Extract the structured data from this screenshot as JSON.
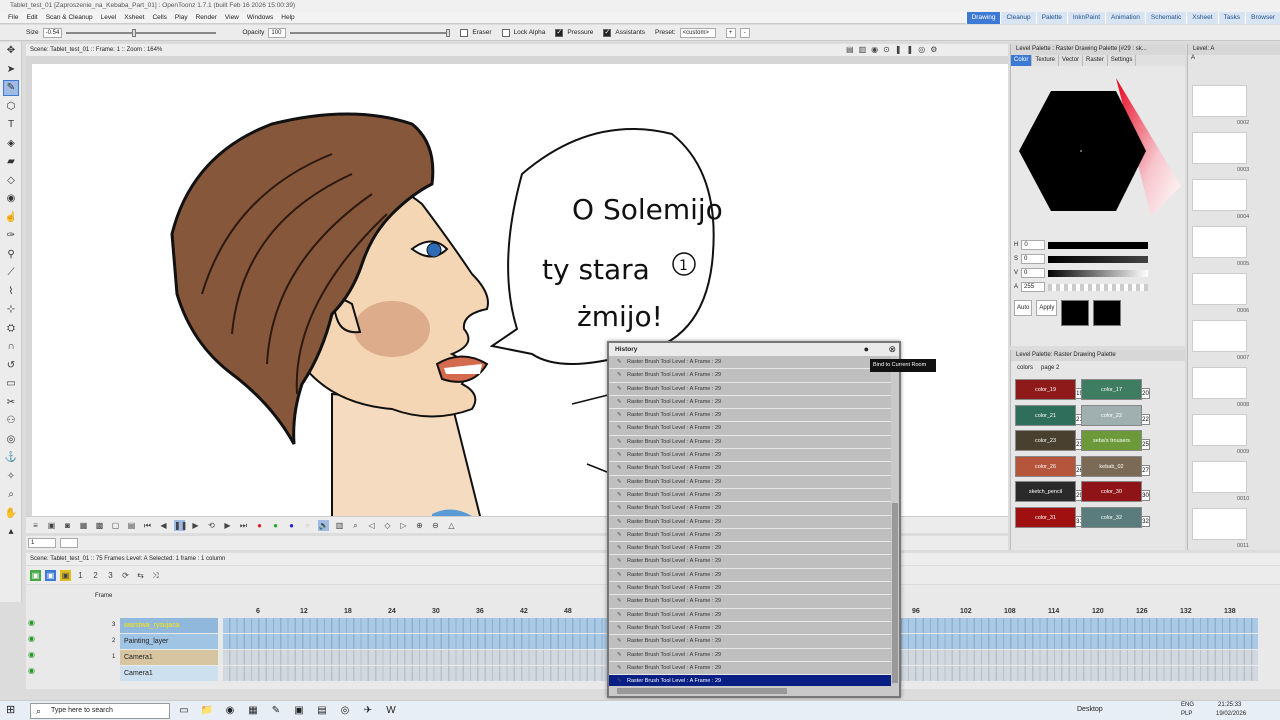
{
  "window": {
    "title": "Tablet_test_01 [Zaproszenie_na_Kebaba_Part_01] : OpenToonz 1.7.1 (built Feb 16 2026 15:00:39)"
  },
  "menu": [
    "File",
    "Edit",
    "Scan & Cleanup",
    "Level",
    "Xsheet",
    "Cells",
    "Play",
    "Render",
    "View",
    "Windows",
    "Help"
  ],
  "rooms": [
    "Drawing",
    "Cleanup",
    "Palette",
    "InknPaint",
    "Animation",
    "Schematic",
    "Xsheet",
    "Tasks",
    "Browser"
  ],
  "tool_options": {
    "size_label": "Size",
    "size_value": "-0.54",
    "opacity_label": "Opacity",
    "opacity_value": "100",
    "eraser": "Eraser",
    "lock_alpha": "Lock Alpha",
    "pressure": "Pressure",
    "assistants": "Assistants",
    "preset_label": "Preset:",
    "preset_value": "<custom>"
  },
  "viewer": {
    "header": "Scene: Tablet_test_01  ::  Frame: 1  ::  Zoom : 164%",
    "frame_field": "1"
  },
  "drawing": {
    "line1": "O  Solemijo",
    "line2": "ty  stara",
    "line3": "żmijo!",
    "circled": "1"
  },
  "style_editor": {
    "title": "Level Palette : Raster Drawing Palette [#29 : sk...",
    "tabs": [
      "Color",
      "Texture",
      "Vector",
      "Raster",
      "Settings"
    ],
    "h_label": "H",
    "h_value": "0",
    "s_label": "S",
    "s_value": "0",
    "v_label": "V",
    "v_value": "0",
    "a_label": "A",
    "a_value": "255",
    "auto_label": "Auto",
    "apply_label": "Apply"
  },
  "palette": {
    "title": "Level Palette: Raster Drawing Palette",
    "tabs": [
      "colors",
      "page 2"
    ],
    "chips": [
      {
        "name": "color_19",
        "idx": "19",
        "color": "#8e1a1a"
      },
      {
        "name": "color_17",
        "idx": "20",
        "color": "#3f7d62"
      },
      {
        "name": "color_21",
        "idx": "21",
        "color": "#2e6e5a"
      },
      {
        "name": "color_22",
        "idx": "22",
        "color": "#a0b0b0"
      },
      {
        "name": "color_23",
        "idx": "23",
        "color": "#4a4030"
      },
      {
        "name": "seba's trousers",
        "idx": "25",
        "color": "#6c9a3a"
      },
      {
        "name": "color_26",
        "idx": "26",
        "color": "#b5563c"
      },
      {
        "name": "kebab_02",
        "idx": "27",
        "color": "#7b6a55"
      },
      {
        "name": "sketch_pencil",
        "idx": "29",
        "color": "#2a2a2a"
      },
      {
        "name": "color_30",
        "idx": "30",
        "color": "#8e1418"
      },
      {
        "name": "color_31",
        "idx": "31",
        "color": "#a01010"
      },
      {
        "name": "color_32",
        "idx": "32",
        "color": "#5a7c7c"
      }
    ]
  },
  "level_strip": {
    "title": "Level: A",
    "level": "A",
    "frames": [
      "0002",
      "0003",
      "0004",
      "0005",
      "0006",
      "0007",
      "0008",
      "0009",
      "0010",
      "0011"
    ]
  },
  "xsheet": {
    "header": "Scene: Tablet_test_01  ::  75 Frames  Level: A  Selected: 1 frame : 1 column",
    "frame_mode": "Frame",
    "frame_numbers": [
      "6",
      "12",
      "18",
      "24",
      "30",
      "36",
      "42",
      "48",
      "96",
      "102",
      "108",
      "114",
      "120",
      "126",
      "132",
      "138"
    ],
    "layers": [
      {
        "num": "3",
        "name": "warstwa_rysujaca"
      },
      {
        "num": "2",
        "name": "Painting_layer"
      },
      {
        "num": "1",
        "name": "Camera1"
      },
      {
        "num": "",
        "name": "Camera1"
      }
    ]
  },
  "history": {
    "title": "History",
    "entries": [
      "Raster Brush Tool   Level : A  Frame : 29",
      "Raster Brush Tool   Level : A  Frame : 29",
      "Raster Brush Tool   Level : A  Frame : 29",
      "Raster Brush Tool   Level : A  Frame : 29",
      "Raster Brush Tool   Level : A  Frame : 29",
      "Raster Brush Tool   Level : A  Frame : 29",
      "Raster Brush Tool   Level : A  Frame : 29",
      "Raster Brush Tool   Level : A  Frame : 29",
      "Raster Brush Tool   Level : A  Frame : 29",
      "Raster Brush Tool   Level : A  Frame : 29",
      "Raster Brush Tool   Level : A  Frame : 29",
      "Raster Brush Tool   Level : A  Frame : 29",
      "Raster Brush Tool   Level : A  Frame : 29",
      "Raster Brush Tool   Level : A  Frame : 29",
      "Raster Brush Tool   Level : A  Frame : 29",
      "Raster Brush Tool   Level : A  Frame : 29",
      "Raster Brush Tool   Level : A  Frame : 29",
      "Raster Brush Tool   Level : A  Frame : 29",
      "Raster Brush Tool   Level : A  Frame : 29",
      "Raster Brush Tool   Level : A  Frame : 29",
      "Raster Brush Tool   Level : A  Frame : 29",
      "Raster Brush Tool   Level : A  Frame : 29",
      "Raster Brush Tool   Level : A  Frame : 29",
      "Raster Brush Tool   Level : A  Frame : 29",
      "Raster Brush Tool   Level : A  Frame : 29"
    ],
    "tooltip": "Bind to Current Room"
  },
  "taskbar": {
    "search_placeholder": "Type here to search",
    "desktop": "Desktop",
    "lang1": "ENG",
    "lang2": "PLP",
    "time": "21:25:33",
    "date": "19/02/2026"
  },
  "colors": {
    "accent": "#3d7ad6",
    "selection": "#0a1f84"
  }
}
